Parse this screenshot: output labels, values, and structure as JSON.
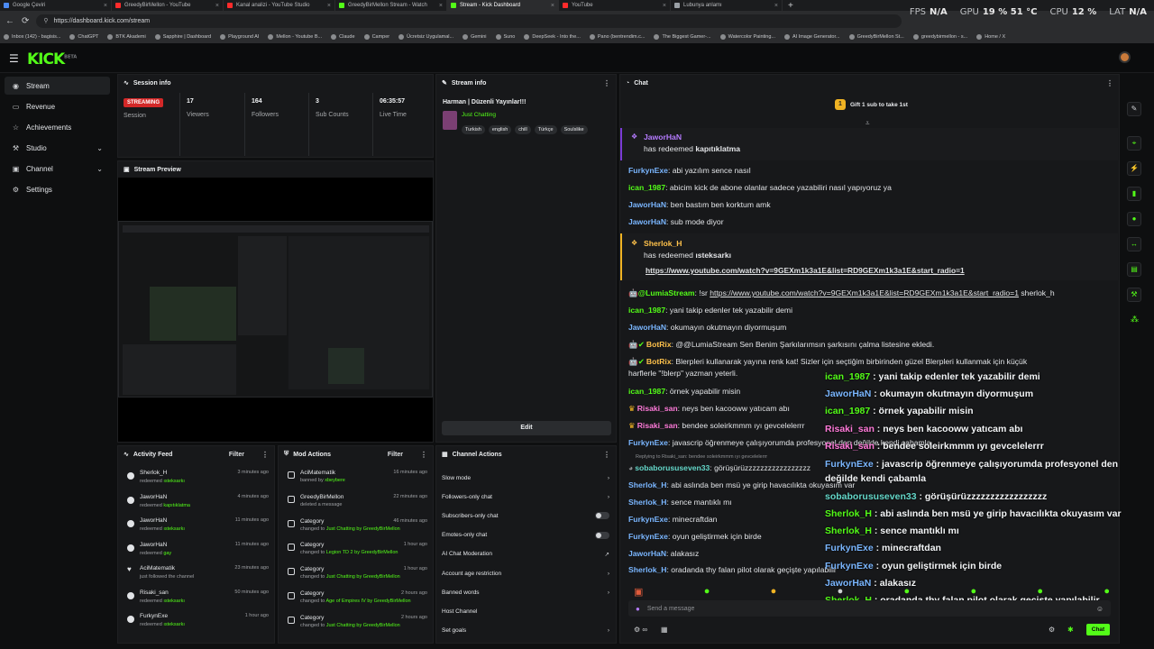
{
  "browser": {
    "tabs": [
      {
        "label": "Google Çeviri",
        "color": "#4c8bf5"
      },
      {
        "label": "GreedyBirMellon - YouTube",
        "color": "#ff2b2b"
      },
      {
        "label": "Kanal analizi - YouTube Studio",
        "color": "#ff2b2b"
      },
      {
        "label": "GreedyBirMellon Stream - Watch",
        "color": "#53fc18"
      },
      {
        "label": "Stream - Kick Dashboard",
        "color": "#53fc18"
      },
      {
        "label": "YouTube",
        "color": "#ff2b2b"
      },
      {
        "label": "Lubunya anlamı",
        "color": "#9aa0a6"
      }
    ],
    "url": "https://dashboard.kick.com/stream",
    "hud": {
      "fps_label": "FPS",
      "fps_value": "N/A",
      "gpu_label": "GPU",
      "gpu_value": "19 % 51 °C",
      "cpu_label": "CPU",
      "cpu_value": "12 %",
      "lat_label": "LAT",
      "lat_value": "N/A"
    },
    "bookmarks": [
      "Inbox (142) - bagisis...",
      "ChatGPT",
      "BTK Akademi",
      "Sapphire | Dashboard",
      "Playground AI",
      "Mellon - Youtube B...",
      "Claude",
      "Camper",
      "Ücretsiz Uygulamal...",
      "Gemini",
      "Suno",
      "DeepSeek - Into the...",
      "Pano (bentrendim.c...",
      "The Biggest Gamer-...",
      "Watercolor Painting...",
      "AI Image Generator...",
      "GreedyBirMellon St...",
      "greedybirmellon - s...",
      "Home / X"
    ]
  },
  "sidebar": {
    "items": [
      {
        "label": "Stream",
        "icon": "broadcast-icon"
      },
      {
        "label": "Revenue",
        "icon": "wallet-icon"
      },
      {
        "label": "Achievements",
        "icon": "trophy-icon"
      },
      {
        "label": "Studio",
        "icon": "studio-icon"
      },
      {
        "label": "Channel",
        "icon": "channel-icon"
      },
      {
        "label": "Settings",
        "icon": "gear-icon"
      }
    ]
  },
  "session": {
    "title": "Session info",
    "status": "STREAMING",
    "status_label": "Session",
    "viewers": "17",
    "viewers_label": "Viewers",
    "followers": "164",
    "followers_label": "Followers",
    "subs": "3",
    "subs_label": "Sub Counts",
    "live_time": "06:35:57",
    "live_time_label": "Live Time"
  },
  "preview": {
    "title": "Stream Preview"
  },
  "stream_info": {
    "title": "Stream info",
    "stream_title": "Harman | Düzenli Yayınlar!!!",
    "category": "Just Chatting",
    "tags": [
      "Turkish",
      "english",
      "chill",
      "Türkçe",
      "Soulslike"
    ],
    "edit_label": "Edit"
  },
  "activity": {
    "title": "Activity Feed",
    "filter": "Filter",
    "rows": [
      {
        "name": "Sherlok_H",
        "action": "redeemed",
        "detail": "ısteksarkı",
        "time": "3 minutes ago",
        "icon": "redeem-icon"
      },
      {
        "name": "JaworHaN",
        "action": "redeemed",
        "detail": "kapıtıklatma",
        "time": "4 minutes ago",
        "icon": "redeem-icon"
      },
      {
        "name": "JaworHaN",
        "action": "redeemed",
        "detail": "ısteksarkı",
        "time": "11 minutes ago",
        "icon": "redeem-icon"
      },
      {
        "name": "JaworHaN",
        "action": "redeemed",
        "detail": "gay",
        "time": "11 minutes ago",
        "icon": "redeem-icon"
      },
      {
        "name": "AciMatematik",
        "action": "just followed the channel",
        "detail": "",
        "time": "23 minutes ago",
        "icon": "heart-icon"
      },
      {
        "name": "Risaki_san",
        "action": "redeemed",
        "detail": "ısteksarkı",
        "time": "50 minutes ago",
        "icon": "redeem-icon"
      },
      {
        "name": "FurkynExe",
        "action": "redeemed",
        "detail": "ısteksarkı",
        "time": "1 hour ago",
        "icon": "redeem-icon"
      }
    ]
  },
  "mod_actions": {
    "title": "Mod Actions",
    "filter": "Filter",
    "rows": [
      {
        "name": "AciMatematik",
        "pre": "banned by",
        "detail": "xbeybere",
        "post": "",
        "time": "16 minutes ago"
      },
      {
        "name": "GreedyBirMellon",
        "pre": "deleted a message",
        "detail": "",
        "post": "",
        "time": "22 minutes ago"
      },
      {
        "name": "Category",
        "pre": "changed to",
        "detail": "Just Chatting",
        "post": "by GreedyBirMellon",
        "time": "46 minutes ago"
      },
      {
        "name": "Category",
        "pre": "changed to",
        "detail": "Legion TD 2",
        "post": "by GreedyBirMellon",
        "time": "1 hour ago"
      },
      {
        "name": "Category",
        "pre": "changed to",
        "detail": "Just Chatting",
        "post": "by GreedyBirMellon",
        "time": "1 hour ago"
      },
      {
        "name": "Category",
        "pre": "changed to",
        "detail": "Age of Empires IV",
        "post": "by GreedyBirMellon",
        "time": "2 hours ago"
      },
      {
        "name": "Category",
        "pre": "changed to",
        "detail": "Just Chatting",
        "post": "by GreedyBirMellon",
        "time": "2 hours ago"
      }
    ]
  },
  "channel_actions": {
    "title": "Channel Actions",
    "rows": [
      {
        "label": "Slow mode",
        "control": "chevron"
      },
      {
        "label": "Followers-only chat",
        "control": "chevron"
      },
      {
        "label": "Subscribers-only chat",
        "control": "toggle"
      },
      {
        "label": "Emotes-only chat",
        "control": "toggle"
      },
      {
        "label": "AI Chat Moderation",
        "control": "external"
      },
      {
        "label": "Account age restriction",
        "control": "chevron"
      },
      {
        "label": "Banned words",
        "control": "chevron"
      },
      {
        "label": "Host Channel",
        "control": "none"
      },
      {
        "label": "Set goals",
        "control": "chevron"
      }
    ]
  },
  "chat": {
    "title": "Chat",
    "gift_label": "Gift 1 sub to take 1st",
    "gift_count": "1",
    "redeem1": {
      "user": "JaworHaN",
      "text": "has redeemed",
      "reward": "kapıtıklatma"
    },
    "redeem2": {
      "user": "Sherlok_H",
      "text": "has redeemed",
      "reward": "ısteksarkı",
      "link": "https://www.youtube.com/watch?v=9GEXm1k3a1E&list=RD9GEXm1k3a1E&start_radio=1"
    },
    "messages_a": [
      {
        "user": "FurkynExe",
        "text": ": abi yazılım sence nasıl",
        "color": "blue"
      },
      {
        "user": "ican_1987",
        "text": ": abicim kick de abone olanlar sadece yazabiliri nasıl yapıyoruz ya",
        "color": "green"
      },
      {
        "user": "JaworHaN",
        "text": ": ben bastım ben korktum amk",
        "color": "blue"
      },
      {
        "user": "JaworHaN",
        "text": ": sub mode diyor",
        "color": "blue"
      }
    ],
    "lumia": {
      "user": "@LumiaStream",
      "text": ": !sr",
      "link": "https://www.youtube.com/watch?v=9GEXm1k3a1E&list=RD9GEXm1k3a1E&start_radio=1",
      "tail": " sherlok_h"
    },
    "messages_b": [
      {
        "user": "ican_1987",
        "text": ": yani takip edenler tek yazabilir demi",
        "color": "green"
      },
      {
        "user": "JaworHaN",
        "text": ": okumayın okutmayın diyormuşum",
        "color": "blue"
      },
      {
        "user": "BotRix",
        "text": ": @@LumiaStream Sen Benim Şarkılarımsın şarkısını çalma listesine ekledi.",
        "color": "gold"
      },
      {
        "user": "BotRix",
        "text": ": Blerpleri kullanarak yayına renk kat! Sizler için seçtiğim birbirinden güzel Blerpleri kullanmak için küçük",
        "color": "gold"
      },
      {
        "user": "",
        "text": "harflerle \"!blerp\" yazman yeterli.",
        "color": ""
      },
      {
        "user": "ican_1987",
        "text": ": örnek yapabilir misin",
        "color": "green"
      },
      {
        "user": "Risaki_san",
        "text": ": neys ben kacooww yatıcam abı",
        "color": "pink"
      },
      {
        "user": "Risaki_san",
        "text": ": bendee soleirkmmm ıyı gevcelelerrr",
        "color": "pink"
      },
      {
        "user": "FurkynExe",
        "text": ": javascrip öğrenmeye çalışıyorumda profesyonel den değilde kendi çabamla",
        "color": "blue"
      }
    ],
    "reply_note": "Replying to Risaki_san: bendee soleirkmmm ıyı gevcelelerrr",
    "messages_c": [
      {
        "user": "sobaborususeven33",
        "text": ": görüşürüzzzzzzzzzzzzzzzzz",
        "color": "teal"
      },
      {
        "user": "Sherlok_H",
        "text": ": abi aslında ben msü ye girip havacılıkta okuyasım var",
        "color": "blue"
      },
      {
        "user": "Sherlok_H",
        "text": ": sence mantıklı mı",
        "color": "blue"
      },
      {
        "user": "FurkynExe",
        "text": ": minecraftdan",
        "color": "blue"
      },
      {
        "user": "FurkynExe",
        "text": ": oyun geliştirmek için birde",
        "color": "blue"
      },
      {
        "user": "JaworHaN",
        "text": ": alakasız",
        "color": "blue"
      },
      {
        "user": "Sherlok_H",
        "text": ": oradanda thy falan pilot olarak geçişte yapılabilir",
        "color": "blue"
      }
    ],
    "input_placeholder": "Send a message",
    "send_label": "Chat"
  },
  "overlay": {
    "messages": [
      {
        "user": "ican_1987",
        "text": " : yani takip edenler tek yazabilir demi",
        "color": "green"
      },
      {
        "user": "JaworHaN",
        "text": " : okumayın okutmayın diyormuşum",
        "color": "blue"
      },
      {
        "user": "ican_1987",
        "text": " : örnek yapabilir misin",
        "color": "green"
      },
      {
        "user": "Risaki_san",
        "text": " : neys ben kacooww yatıcam abı",
        "color": "pink"
      },
      {
        "user": "Risaki_san",
        "text": " : bendee soleirkmmm ıyı gevcelelerrr",
        "color": "pink"
      },
      {
        "user": "FurkynExe",
        "text": " : javascrip öğrenmeye çalışıyorumda profesyonel den",
        "color": "blue"
      },
      {
        "user": "",
        "text": "değilde kendi çabamla",
        "color": ""
      },
      {
        "user": "sobaborususeven33",
        "text": " : görüşürüzzzzzzzzzzzzzzzzz",
        "color": "teal"
      },
      {
        "user": "Sherlok_H",
        "text": " : abi aslında ben msü ye girip havacılıkta okuyasım var",
        "color": "green"
      },
      {
        "user": "Sherlok_H",
        "text": " : sence mantıklı mı",
        "color": "green"
      },
      {
        "user": "FurkynExe",
        "text": " : minecraftdan",
        "color": "blue"
      },
      {
        "user": "FurkynExe",
        "text": " : oyun geliştirmek için birde",
        "color": "blue"
      },
      {
        "user": "JaworHaN",
        "text": " : alakasız",
        "color": "blue"
      },
      {
        "user": "Sherlok_H",
        "text": " : oradanda thy falan pilot olarak geçişte yapılabilir",
        "color": "green"
      }
    ]
  }
}
